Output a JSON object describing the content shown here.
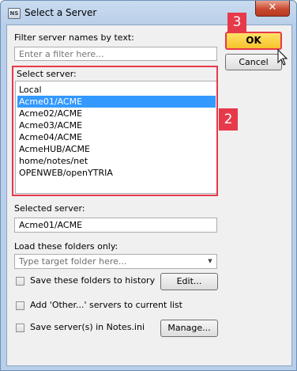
{
  "window": {
    "title": "Select a Server",
    "app_icon": "notes-app-icon",
    "close_symbol": "✕"
  },
  "filter": {
    "label": "Filter server names by text:",
    "placeholder": "Enter a filter here..."
  },
  "buttons": {
    "ok": "OK",
    "cancel": "Cancel",
    "edit": "Edit...",
    "manage": "Manage..."
  },
  "server_list": {
    "label": "Select server:",
    "items": [
      "Local",
      "Acme01/ACME",
      "Acme02/ACME",
      "Acme03/ACME",
      "Acme04/ACME",
      "AcmeHUB/ACME",
      "home/notes/net",
      "OPENWEB/openYTRIA"
    ],
    "selected_index": 1
  },
  "selected_server": {
    "label": "Selected server:",
    "value": "Acme01/ACME"
  },
  "folders": {
    "label": "Load these folders only:",
    "placeholder": "Type target folder here..."
  },
  "options": {
    "save_history": "Save these folders to history",
    "add_other": "Add 'Other...' servers to current list",
    "save_notes_ini": "Save server(s) in Notes.ini",
    "save_history_checked": false,
    "add_other_checked": false,
    "save_notes_ini_checked": false
  },
  "annotations": {
    "callout_ok": "3",
    "callout_list": "2"
  },
  "colors": {
    "annotation": "#e6394a",
    "selection": "#3399ff",
    "ok_button": "#f6c42b"
  }
}
